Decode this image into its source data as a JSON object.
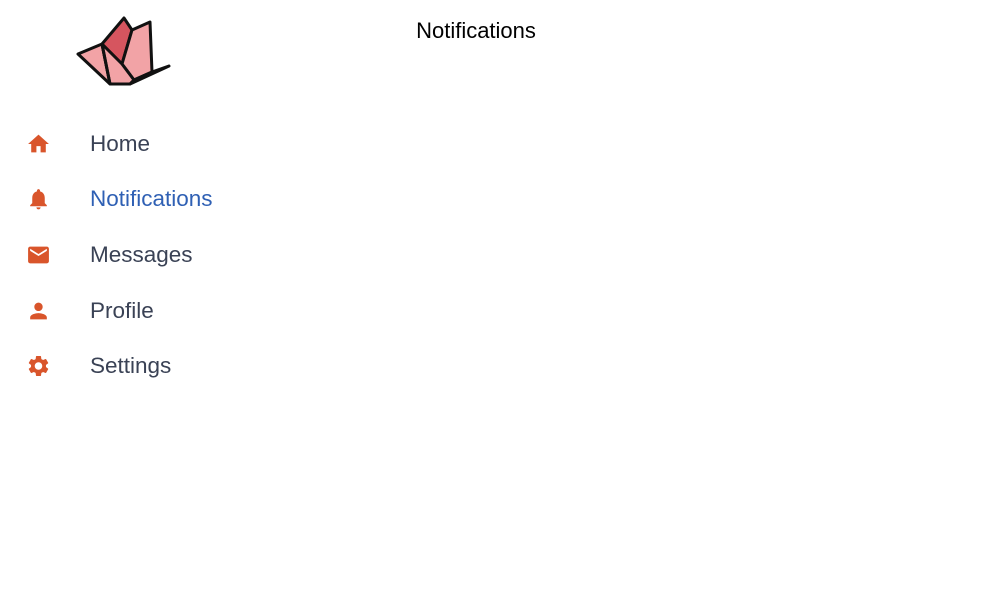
{
  "colors": {
    "accent": "#d9552b",
    "active": "#2f60b4",
    "text": "#3a4255"
  },
  "header": {
    "title": "Notifications"
  },
  "logo": {
    "icon": "origami-crane-icon"
  },
  "sidebar": {
    "items": [
      {
        "label": "Home",
        "icon": "home-icon",
        "active": false
      },
      {
        "label": "Notifications",
        "icon": "bell-icon",
        "active": true
      },
      {
        "label": "Messages",
        "icon": "mail-icon",
        "active": false
      },
      {
        "label": "Profile",
        "icon": "person-icon",
        "active": false
      },
      {
        "label": "Settings",
        "icon": "gear-icon",
        "active": false
      }
    ]
  }
}
